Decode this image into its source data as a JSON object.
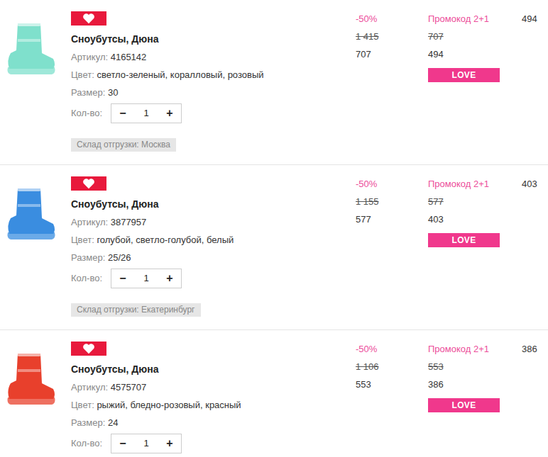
{
  "items": [
    {
      "title": "Сноубутсы, Дюна",
      "article_label": "Артикул:",
      "article": "4165142",
      "color_label": "Цвет:",
      "colors": "светло-зеленый, коралловый, розовый",
      "size_label": "Размер:",
      "size": "30",
      "qty_label": "Кол-во:",
      "minus": "−",
      "qty": "1",
      "plus": "+",
      "warehouse": "Склад отгрузки: Москва",
      "discount": "-50%",
      "old_price": "1 415",
      "price": "707",
      "promo": "Промокод 2+1",
      "promo_old_price": "707",
      "promo_price": "494",
      "promo_badge": "LOVE",
      "total": "494",
      "color": "#7fe0cc"
    },
    {
      "title": "Сноубутсы, Дюна",
      "article_label": "Артикул:",
      "article": "3877957",
      "color_label": "Цвет:",
      "colors": "голубой, светло-голубой, белый",
      "size_label": "Размер:",
      "size": "25/26",
      "qty_label": "Кол-во:",
      "minus": "−",
      "qty": "1",
      "plus": "+",
      "warehouse": "Склад отгрузки: Екатеринбург",
      "discount": "-50%",
      "old_price": "1 155",
      "price": "577",
      "promo": "Промокод 2+1",
      "promo_old_price": "577",
      "promo_price": "403",
      "promo_badge": "LOVE",
      "total": "403",
      "color": "#3a8de0"
    },
    {
      "title": "Сноубутсы, Дюна",
      "article_label": "Артикул:",
      "article": "4575707",
      "color_label": "Цвет:",
      "colors": "рыжий, бледно-розовый, красный",
      "size_label": "Размер:",
      "size": "24",
      "qty_label": "Кол-во:",
      "minus": "−",
      "qty": "1",
      "plus": "+",
      "discount": "-50%",
      "old_price": "1 106",
      "price": "553",
      "promo": "Промокод 2+1",
      "promo_old_price": "553",
      "promo_price": "386",
      "promo_badge": "LOVE",
      "total": "386",
      "color": "#e8402c"
    }
  ]
}
